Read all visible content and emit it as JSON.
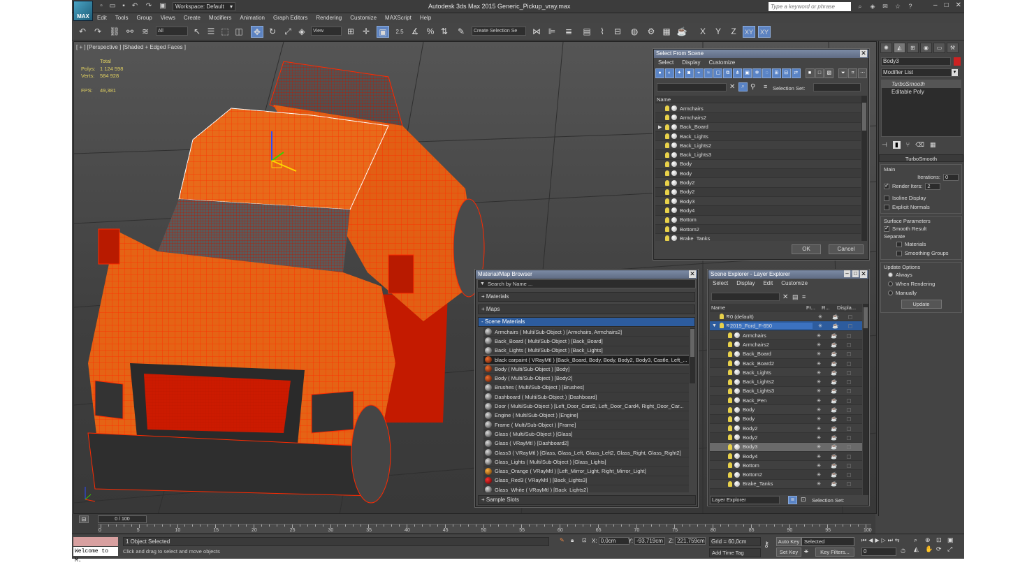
{
  "titlebar": {
    "workspace": "Workspace: Default",
    "title": "Autodesk 3ds Max  2015     Generic_Pickup_vray.max",
    "search_placeholder": "Type a keyword or phrase",
    "logo": "MAX"
  },
  "menu": [
    "Edit",
    "Tools",
    "Group",
    "Views",
    "Create",
    "Modifiers",
    "Animation",
    "Graph Editors",
    "Rendering",
    "Customize",
    "MAXScript",
    "Help"
  ],
  "toolbar": {
    "filter": "All",
    "refcoord": "View",
    "snap_label": "2.5",
    "selection_set": "Create Selection Se",
    "axes": [
      "X",
      "Y",
      "Z",
      "XY",
      "XY"
    ]
  },
  "viewport": {
    "label": "[ + ] [Perspective ] [Shaded + Edged Faces ]",
    "stats": {
      "total_label": "Total",
      "polys_label": "Polys:",
      "polys": "1 124 598",
      "verts_label": "Verts:",
      "verts": "584 928",
      "fps_label": "FPS:",
      "fps": "49,381"
    }
  },
  "select_from_scene": {
    "title": "Select From Scene",
    "menu": [
      "Select",
      "Display",
      "Customize"
    ],
    "selection_set_label": "Selection Set:",
    "column": "Name",
    "items": [
      "Armchairs",
      "Armchairs2",
      "Back_Board",
      "Back_Lights",
      "Back_Lights2",
      "Back_Lights3",
      "Body",
      "Body",
      "Body2",
      "Body2",
      "Body3",
      "Body4",
      "Bottom",
      "Bottom2",
      "Brake_Tanks"
    ],
    "ok": "OK",
    "cancel": "Cancel"
  },
  "material_browser": {
    "title": "Material/Map Browser",
    "search": "Search by Name ...",
    "sections": [
      "+ Materials",
      "+ Maps",
      "- Scene Materials"
    ],
    "items": [
      "Armchairs  ( Multi/Sub-Object ) [Armchairs, Armchairs2]",
      "Back_Board  ( Multi/Sub-Object ) [Back_Board]",
      "Back_Lights  ( Multi/Sub-Object ) [Back_Lights]",
      "black carpaint  ( VRayMtl ) [Back_Board, Body, Body, Body2, Body3, Castle, Left_...",
      "Body  ( Multi/Sub-Object ) [Body]",
      "Body  ( Multi/Sub-Object ) [Body2]",
      "Brushes  ( Multi/Sub-Object ) [Brushes]",
      "Dashboard  ( Multi/Sub-Object ) [Dashboard]",
      "Door  ( Multi/Sub-Object ) [Left_Door_Card2, Left_Door_Card4, Right_Door_Car...",
      "Engine  ( Multi/Sub-Object ) [Engine]",
      "Frame  ( Multi/Sub-Object ) [Frame]",
      "Glass  ( Multi/Sub-Object ) [Glass]",
      "Glass  ( VRayMtl ) [Dashboard2]",
      "Glass3  ( VRayMtl ) [Glass, Glass_Left, Glass_Left2, Glass_Right, Glass_Right2]",
      "Glass_Lights  ( Multi/Sub-Object ) [Glass_Lights]",
      "Glass_Orange  ( VRayMtl ) [Left_Mirror_Light, Right_Mirror_Light]",
      "Glass_Red3  ( VRayMtl ) [Back_Lights3]",
      "Glass_White  ( VRayMtl ) [Back_Lights2]"
    ],
    "sample_slots": "+ Sample Slots"
  },
  "scene_explorer": {
    "title": "Scene Explorer - Layer Explorer",
    "menu": [
      "Select",
      "Display",
      "Edit",
      "Customize"
    ],
    "columns": [
      "Name",
      "Fr...",
      "R...",
      "Displa..."
    ],
    "layers": [
      "0 (default)",
      "2019_Ford_F-650"
    ],
    "items": [
      "Armchairs",
      "Armchairs2",
      "Back_Board",
      "Back_Board2",
      "Back_Lights",
      "Back_Lights2",
      "Back_Lights3",
      "Back_Pen",
      "Body",
      "Body",
      "Body2",
      "Body2",
      "Body3",
      "Body4",
      "Bottom",
      "Bottom2",
      "Brake_Tanks"
    ],
    "footer_dropdown": "Layer Explorer",
    "footer_label": "Selection Set:"
  },
  "command_panel": {
    "object_name": "Body3",
    "modifier_list": "Modifier List",
    "stack": [
      "TurboSmooth",
      "Editable Poly"
    ],
    "turbosmooth": {
      "title": "TurboSmooth",
      "main": "Main",
      "iterations_label": "Iterations:",
      "iterations": "0",
      "render_iters_label": "Render Iters:",
      "render_iters": "2",
      "isoline": "Isoline Display",
      "explicit": "Explicit Normals",
      "surface": "Surface Parameters",
      "smooth_result": "Smooth Result",
      "separate": "Separate",
      "materials": "Materials",
      "smoothing_groups": "Smoothing Groups",
      "update_options": "Update Options",
      "always": "Always",
      "when_rendering": "When Rendering",
      "manually": "Manually",
      "update": "Update"
    }
  },
  "timeline": {
    "slider": "0 / 100",
    "ticks": [
      "0",
      "5",
      "10",
      "15",
      "20",
      "25",
      "30",
      "35",
      "40",
      "45",
      "50",
      "55",
      "60",
      "65",
      "70",
      "75",
      "80",
      "85",
      "90",
      "95",
      "100"
    ]
  },
  "status": {
    "script": "Welcome to M.",
    "selected": "1 Object Selected",
    "prompt": "Click and drag to select and move objects",
    "x_label": "X:",
    "x": "0,0cm",
    "y_label": "Y:",
    "y": "-93,719cm",
    "z_label": "Z:",
    "z": "221,759cm",
    "grid": "Grid = 60,0cm",
    "add_time_tag": "Add Time Tag",
    "auto_key": "Auto Key",
    "set_key": "Set Key",
    "key_mode": "Selected",
    "key_filters": "Key Filters...",
    "frame": "0"
  },
  "colors": {
    "accent": "#5a84c6",
    "wire": "#ff2a00",
    "body": "#e86a1a",
    "stats": "#e0d060"
  }
}
